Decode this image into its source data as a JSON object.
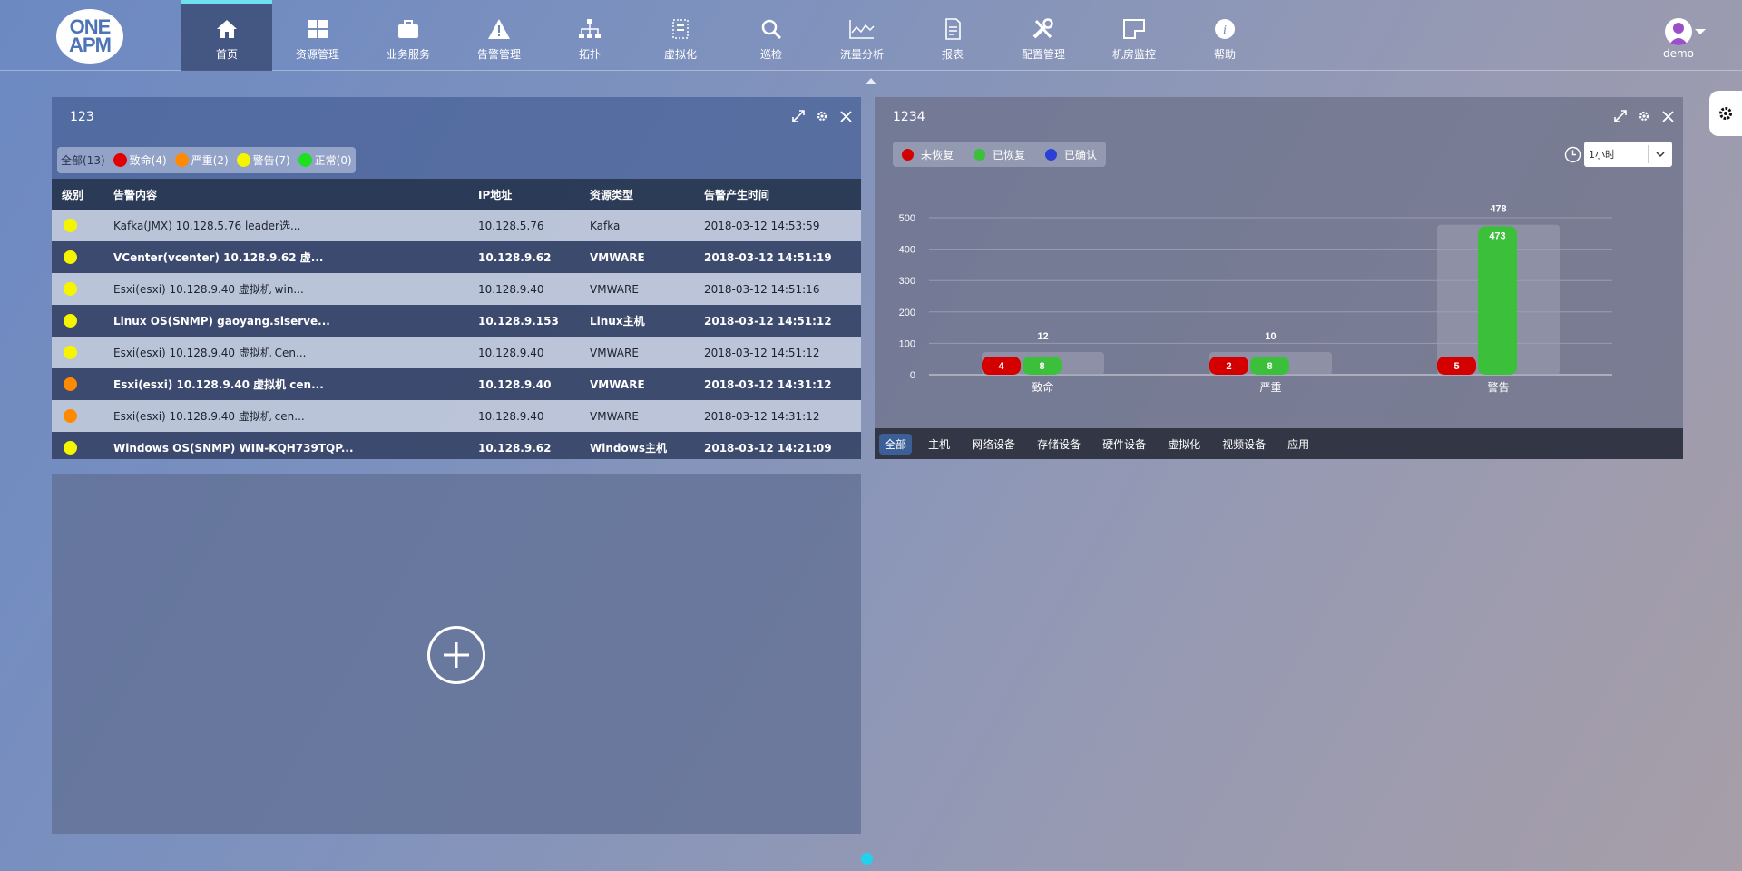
{
  "logo": {
    "line1": "ONE",
    "line2": "APM"
  },
  "nav": [
    {
      "label": "首页",
      "icon": "home-icon"
    },
    {
      "label": "资源管理",
      "icon": "grid-icon"
    },
    {
      "label": "业务服务",
      "icon": "briefcase-icon"
    },
    {
      "label": "告警管理",
      "icon": "warning-icon"
    },
    {
      "label": "拓扑",
      "icon": "topology-icon"
    },
    {
      "label": "虚拟化",
      "icon": "virtual-icon"
    },
    {
      "label": "巡检",
      "icon": "search-icon"
    },
    {
      "label": "流量分析",
      "icon": "traffic-icon"
    },
    {
      "label": "报表",
      "icon": "report-icon"
    },
    {
      "label": "配置管理",
      "icon": "tools-icon"
    },
    {
      "label": "机房监控",
      "icon": "room-icon"
    },
    {
      "label": "帮助",
      "icon": "help-icon"
    }
  ],
  "active_nav": "首页",
  "user": {
    "name": "demo"
  },
  "alerts_panel": {
    "title": "123",
    "filters": [
      {
        "label": "全部(13)",
        "color": ""
      },
      {
        "label": "致命(4)",
        "color": "#e00000"
      },
      {
        "label": "严重(2)",
        "color": "#ff8a00"
      },
      {
        "label": "警告(7)",
        "color": "#f5f500"
      },
      {
        "label": "正常(0)",
        "color": "#1ee01e"
      }
    ],
    "columns": {
      "level": "级别",
      "content": "告警内容",
      "ip": "IP地址",
      "type": "资源类型",
      "time": "告警产生时间"
    },
    "rows": [
      {
        "severity": "#f5f500",
        "content": "Kafka(JMX) 10.128.5.76 leader选...",
        "ip": "10.128.5.76",
        "type": "Kafka",
        "time": "2018-03-12 14:53:59"
      },
      {
        "severity": "#f5f500",
        "content": "VCenter(vcenter) 10.128.9.62 虚...",
        "ip": "10.128.9.62",
        "type": "VMWARE",
        "time": "2018-03-12 14:51:19"
      },
      {
        "severity": "#f5f500",
        "content": "Esxi(esxi) 10.128.9.40 虚拟机 win...",
        "ip": "10.128.9.40",
        "type": "VMWARE",
        "time": "2018-03-12 14:51:16"
      },
      {
        "severity": "#f5f500",
        "content": "Linux OS(SNMP) gaoyang.siserve...",
        "ip": "10.128.9.153",
        "type": "Linux主机",
        "time": "2018-03-12 14:51:12"
      },
      {
        "severity": "#f5f500",
        "content": "Esxi(esxi) 10.128.9.40 虚拟机 Cen...",
        "ip": "10.128.9.40",
        "type": "VMWARE",
        "time": "2018-03-12 14:51:12"
      },
      {
        "severity": "#ff8a00",
        "content": "Esxi(esxi) 10.128.9.40 虚拟机 cen...",
        "ip": "10.128.9.40",
        "type": "VMWARE",
        "time": "2018-03-12 14:31:12"
      },
      {
        "severity": "#ff8a00",
        "content": "Esxi(esxi) 10.128.9.40 虚拟机 cen...",
        "ip": "10.128.9.40",
        "type": "VMWARE",
        "time": "2018-03-12 14:31:12"
      },
      {
        "severity": "#f5f500",
        "content": "Windows OS(SNMP) WIN-KQH739TQP...",
        "ip": "10.128.9.62",
        "type": "Windows主机",
        "time": "2018-03-12 14:21:09"
      }
    ]
  },
  "chart_panel": {
    "title": "1234",
    "legend": [
      {
        "label": "未恢复",
        "color": "#d40000"
      },
      {
        "label": "已恢复",
        "color": "#3cc03c"
      },
      {
        "label": "已确认",
        "color": "#2a3fd6"
      }
    ],
    "time_range": "1小时",
    "tabs": [
      "全部",
      "主机",
      "网络设备",
      "存储设备",
      "硬件设备",
      "虚拟化",
      "视频设备",
      "应用"
    ],
    "active_tab": "全部"
  },
  "chart_data": {
    "type": "bar",
    "categories": [
      "致命",
      "严重",
      "警告"
    ],
    "totals": [
      12,
      10,
      478
    ],
    "series": [
      {
        "name": "未恢复",
        "values": [
          4,
          2,
          5
        ],
        "color": "#d40000"
      },
      {
        "name": "已恢复",
        "values": [
          8,
          8,
          473
        ],
        "color": "#3cc03c"
      }
    ],
    "y_ticks": [
      0,
      100,
      200,
      300,
      400,
      500
    ],
    "ylim": [
      0,
      500
    ],
    "grid": true
  }
}
